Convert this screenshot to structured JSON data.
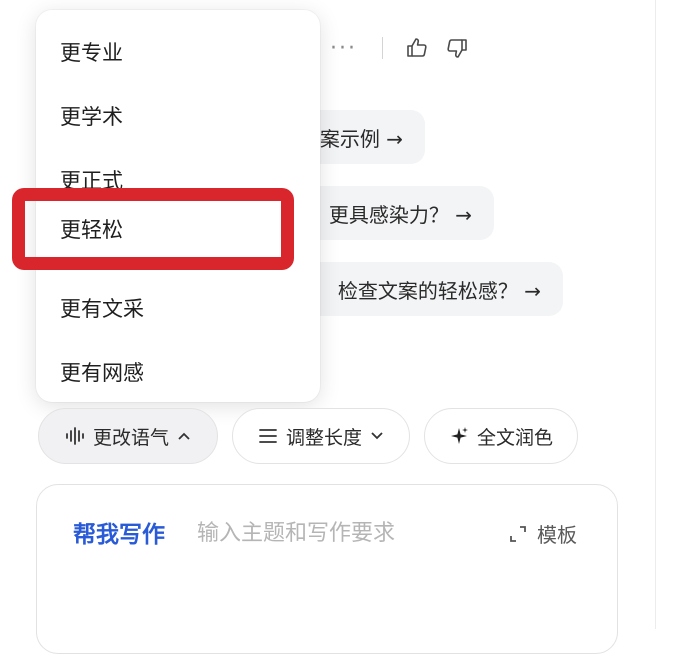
{
  "actions": {
    "more_label": "···",
    "icons": [
      "thumbs-up-icon",
      "thumbs-down-icon"
    ]
  },
  "suggestions": [
    {
      "text": "案示例 →"
    },
    {
      "text": "更具感染力？ →"
    },
    {
      "text": "检查文案的轻松感？ →"
    }
  ],
  "tone_menu": {
    "items": [
      "更专业",
      "更学术",
      "更正式",
      "更轻松",
      "更有文采",
      "更有网感"
    ],
    "selected": "更轻松"
  },
  "tools": {
    "tone_label": "更改语气",
    "length_label": "调整长度",
    "polish_label": "全文润色"
  },
  "writer": {
    "title": "帮我写作",
    "placeholder": "输入主题和写作要求",
    "template_label": "模板"
  },
  "colors": {
    "highlight": "#d8262c",
    "accent": "#2a5bd7"
  }
}
